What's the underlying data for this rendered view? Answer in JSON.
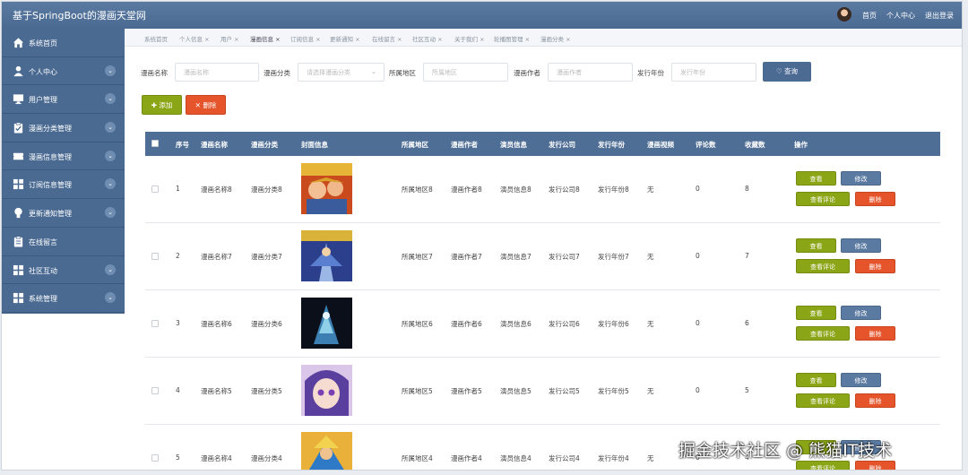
{
  "app": {
    "title": "基于SpringBoot的漫画天堂网"
  },
  "topnav": [
    "首页",
    "个人中心",
    "退出登录"
  ],
  "sidebar": {
    "items": [
      {
        "label": "系统首页",
        "icon": "home-icon",
        "chevron": false
      },
      {
        "label": "个人中心",
        "icon": "user-icon",
        "chevron": true
      },
      {
        "label": "用户管理",
        "icon": "monitor-icon",
        "chevron": true
      },
      {
        "label": "漫画分类管理",
        "icon": "clipboard-check-icon",
        "chevron": true
      },
      {
        "label": "漫画信息管理",
        "icon": "ticket-icon",
        "chevron": true
      },
      {
        "label": "订阅信息管理",
        "icon": "grid-icon",
        "chevron": true
      },
      {
        "label": "更新通知管理",
        "icon": "bulb-icon",
        "chevron": true
      },
      {
        "label": "在线留言",
        "icon": "clipboard-icon",
        "chevron": false
      },
      {
        "label": "社区互动",
        "icon": "grid-icon",
        "chevron": true
      },
      {
        "label": "系统管理",
        "icon": "grid-icon",
        "chevron": true
      }
    ]
  },
  "tabs": [
    {
      "label": "系统首页",
      "closable": false
    },
    {
      "label": "个人信息 ×",
      "closable": true
    },
    {
      "label": "用户 ×",
      "closable": true
    },
    {
      "label": "漫画信息 ×",
      "closable": true,
      "active": true
    },
    {
      "label": "订阅信息 ×",
      "closable": true
    },
    {
      "label": "更新通知 ×",
      "closable": true
    },
    {
      "label": "在线留言 ×",
      "closable": true
    },
    {
      "label": "社区互动 ×",
      "closable": true
    },
    {
      "label": "关于我们 ×",
      "closable": true
    },
    {
      "label": "轮播图管理 ×",
      "closable": true
    },
    {
      "label": "漫画分类 ×",
      "closable": true
    }
  ],
  "search": {
    "name_label": "漫画名称",
    "name_placeholder": "漫画名称",
    "category_label": "漫画分类",
    "category_placeholder": "请选择漫画分类",
    "region_label": "所属地区",
    "region_placeholder": "所属地区",
    "author_label": "漫画作者",
    "author_placeholder": "漫画作者",
    "year_label": "发行年份",
    "year_placeholder": "发行年份",
    "query_button": "查询"
  },
  "actions": {
    "add": "添加",
    "delete": "删除"
  },
  "table": {
    "headers": [
      "序号",
      "漫画名称",
      "漫画分类",
      "封面信息",
      "所属地区",
      "漫画作者",
      "演员信息",
      "发行公司",
      "发行年份",
      "漫画视频",
      "评论数",
      "收藏数",
      "操作"
    ],
    "rows": [
      {
        "index": "1",
        "name": "漫画名称8",
        "category": "漫画分类8",
        "region": "所属地区8",
        "author": "漫画作者8",
        "actors": "演员信息8",
        "company": "发行公司8",
        "year": "发行年份8",
        "video": "无",
        "comments": "0",
        "favorites": "8"
      },
      {
        "index": "2",
        "name": "漫画名称7",
        "category": "漫画分类7",
        "region": "所属地区7",
        "author": "漫画作者7",
        "actors": "演员信息7",
        "company": "发行公司7",
        "year": "发行年份7",
        "video": "无",
        "comments": "0",
        "favorites": "7"
      },
      {
        "index": "3",
        "name": "漫画名称6",
        "category": "漫画分类6",
        "region": "所属地区6",
        "author": "漫画作者6",
        "actors": "演员信息6",
        "company": "发行公司6",
        "year": "发行年份6",
        "video": "无",
        "comments": "0",
        "favorites": "6"
      },
      {
        "index": "4",
        "name": "漫画名称5",
        "category": "漫画分类5",
        "region": "所属地区5",
        "author": "漫画作者5",
        "actors": "演员信息5",
        "company": "发行公司5",
        "year": "发行年份5",
        "video": "无",
        "comments": "0",
        "favorites": "5"
      },
      {
        "index": "5",
        "name": "漫画名称4",
        "category": "漫画分类4",
        "region": "所属地区4",
        "author": "漫画作者4",
        "actors": "演员信息4",
        "company": "发行公司4",
        "year": "发行年份4",
        "video": "无",
        "comments": "0",
        "favorites": "4"
      }
    ],
    "row_buttons": {
      "view": "查看",
      "edit": "修改",
      "comments": "查看评论",
      "delete": "删除"
    }
  },
  "watermark": "掘金技术社区 @ 熊猫IT技术",
  "colors": {
    "header": "#4a6a92",
    "view": "#8aa516",
    "edit": "#5b7aa1",
    "delete": "#e5542b"
  }
}
